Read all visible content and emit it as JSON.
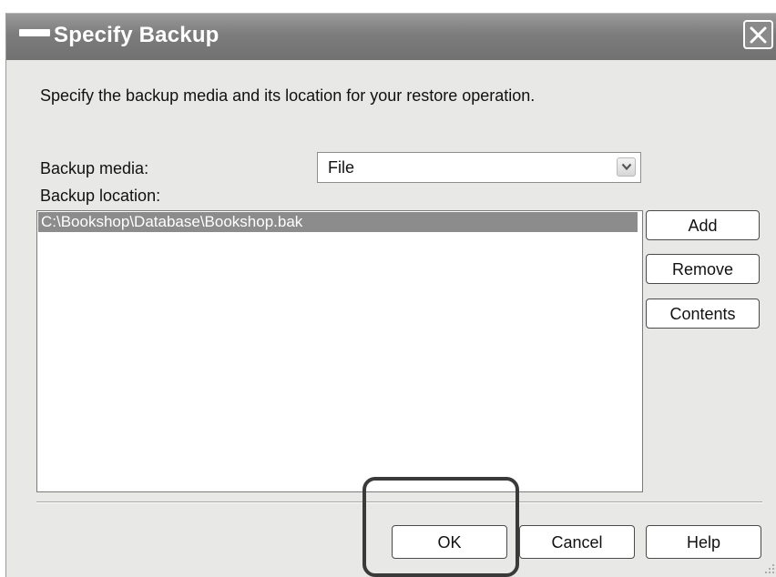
{
  "window": {
    "title": "Specify Backup",
    "close_icon": "close-icon",
    "title_icon": "window-icon"
  },
  "dialog": {
    "description": "Specify the backup media and its location for your restore operation.",
    "backup_media_label": "Backup media:",
    "backup_media_value": "File",
    "backup_media_arrow_icon": "chevron-down-icon",
    "backup_location_label": "Backup location:",
    "locations": [
      "C:\\Bookshop\\Database\\Bookshop.bak"
    ],
    "side_buttons": {
      "add": "Add",
      "remove": "Remove",
      "contents": "Contents"
    },
    "footer_buttons": {
      "ok": "OK",
      "cancel": "Cancel",
      "help": "Help"
    }
  },
  "colors": {
    "titlebar": "#7c7c7c",
    "dialog_bg": "#e8e8e6",
    "selection": "#8c8c8c",
    "highlight_box": "#3a3a3a"
  }
}
